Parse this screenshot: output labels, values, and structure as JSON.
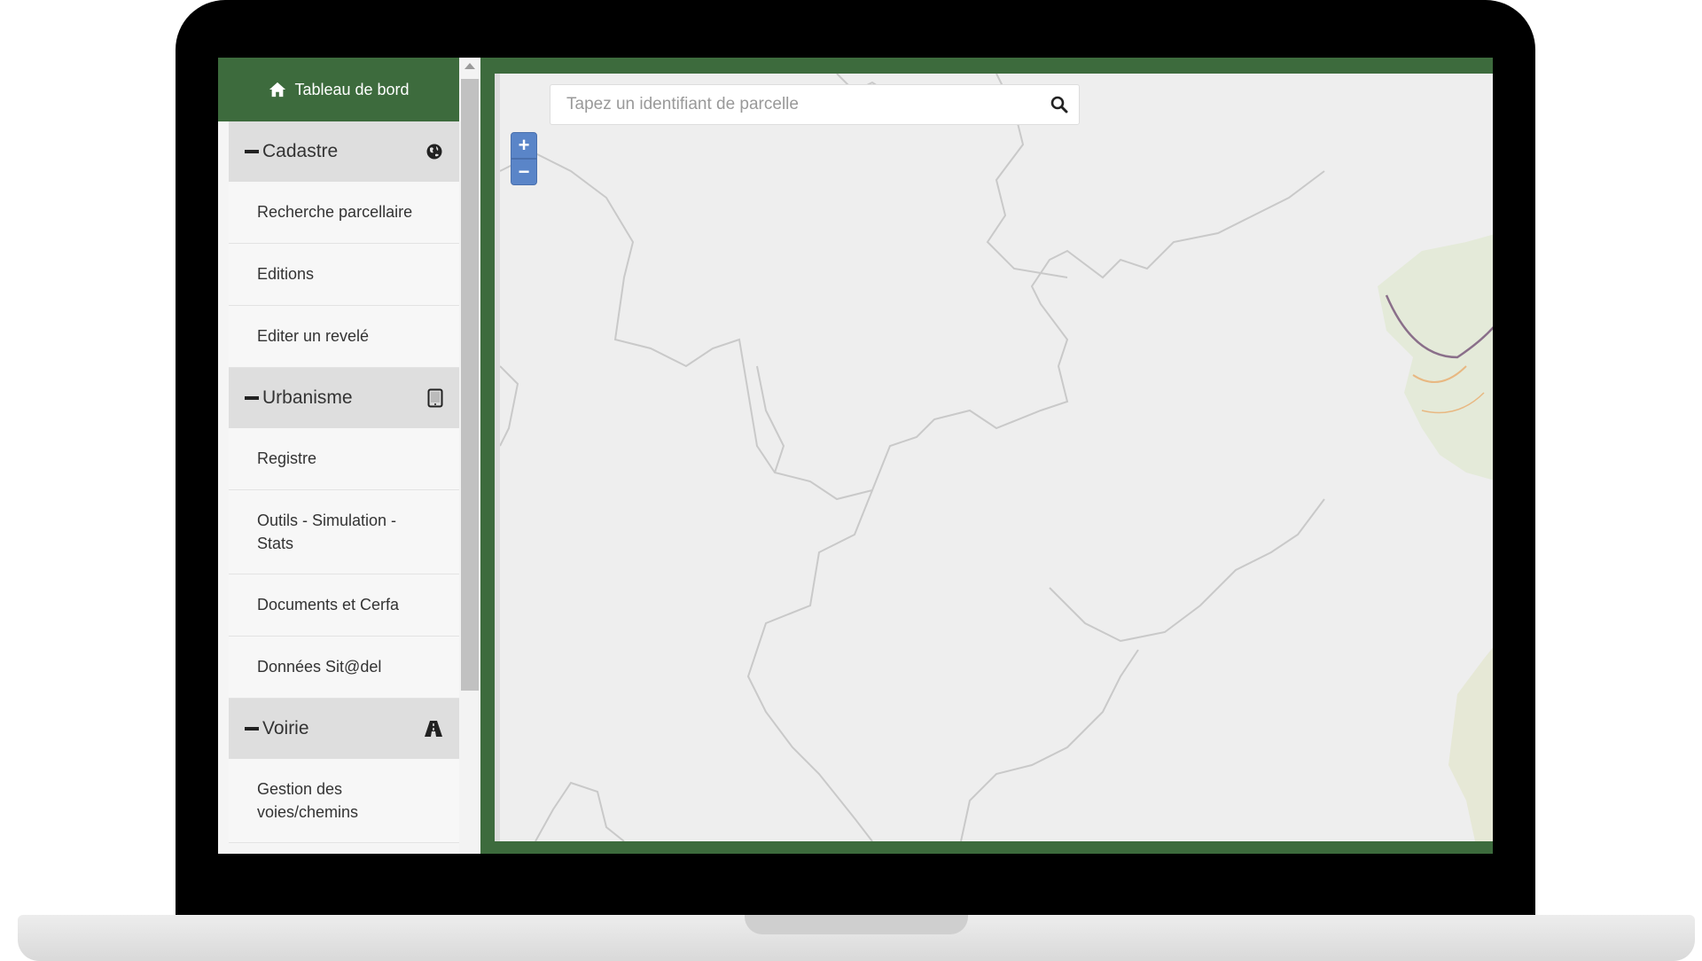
{
  "header": {
    "home_label": "Tableau de bord",
    "home_icon": "home-icon"
  },
  "sidebar": {
    "sections": [
      {
        "title": "Cadastre",
        "icon": "globe-icon",
        "items": [
          "Recherche parcellaire",
          "Editions",
          "Editer un revelé"
        ]
      },
      {
        "title": "Urbanisme",
        "icon": "tablet-icon",
        "items": [
          "Registre",
          "Outils - Simulation - Stats",
          "Documents et Cerfa",
          "Données Sit@del"
        ]
      },
      {
        "title": "Voirie",
        "icon": "road-icon",
        "items": [
          "Gestion des voies/chemins"
        ]
      }
    ]
  },
  "search": {
    "placeholder": "Tapez un identifiant de parcelle",
    "value": "",
    "icon": "search-icon"
  },
  "map": {
    "zoom_in_label": "+",
    "zoom_out_label": "−"
  },
  "colors": {
    "brand_green": "#3d6b3d",
    "zoom_blue": "#5a85c8",
    "section_bg": "#dedede"
  }
}
